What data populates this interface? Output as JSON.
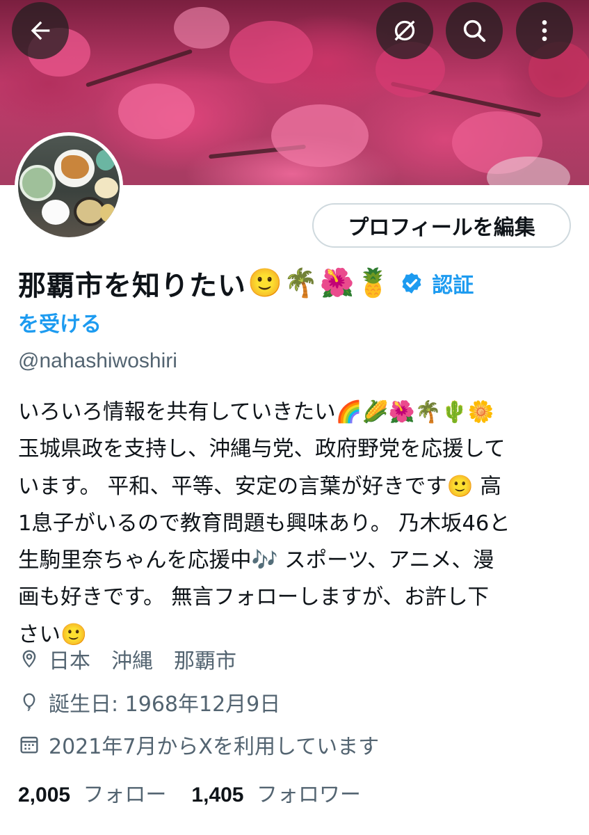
{
  "header": {
    "back_icon": "arrow-left-icon",
    "no_translate_icon": "circle-slash-icon",
    "search_icon": "search-icon",
    "more_icon": "more-vertical-icon"
  },
  "profile": {
    "edit_button_label": "プロフィールを編集",
    "display_name": "那覇市を知りたい",
    "name_emojis": [
      "🙂",
      "🌴",
      "🌺",
      "🍍"
    ],
    "verified_badge_icon": "verified-badge-icon",
    "verify_link_line1": "認証",
    "verify_link_line2": "を受ける",
    "handle": "@nahashiwoshiri",
    "bio_lines": [
      "いろいろ情報を共有していきたい🌈🌽🌺🌴🌵🌼",
      "玉城県政を支持し、沖縄与党、政府野党を応援して",
      "います。 平和、平等、安定の言葉が好きです🙂 高",
      "1息子がいるので教育問題も興味あり。 乃木坂46と",
      "生駒里奈ちゃんを応援中🎶 スポーツ、アニメ、漫",
      "画も好きです。 無言フォローしますが、お許し下",
      "さい🙂"
    ],
    "location": "日本　沖縄　那覇市",
    "birthday": "誕生日: 1968年12月9日",
    "joined": "2021年7月からXを利用しています",
    "following_count": "2,005",
    "following_label": "フォロー",
    "followers_count": "1,405",
    "followers_label": "フォロワー"
  },
  "colors": {
    "accent": "#1d9bf0",
    "text_primary": "#0f1419",
    "text_secondary": "#536471",
    "border": "#cfd9de"
  }
}
